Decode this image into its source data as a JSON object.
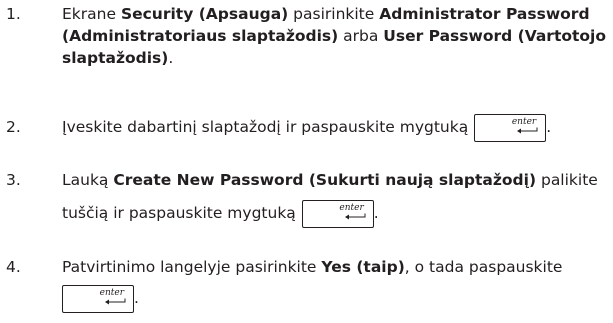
{
  "steps": [
    {
      "number": "1.",
      "line1": {
        "t1": "Ekrane ",
        "b1": "Security (Apsauga)",
        "t2": " pasirinkite ",
        "b2": "Administrator Password"
      },
      "line2": {
        "b1": "(Administratoriaus slaptažodis)",
        "t1": " arba ",
        "b2": "User Password (Vartotojo"
      },
      "line3": {
        "b1": "slaptažodis)",
        "t1": "."
      }
    },
    {
      "number": "2.",
      "text": "Įveskite dabartinį slaptažodį ir paspauskite mygtuką",
      "after_key": "."
    },
    {
      "number": "3.",
      "line1": {
        "t1": "Lauką ",
        "b1": "Create New Password (Sukurti naują slaptažodį)",
        "t2": " palikite"
      },
      "line2": {
        "t1": "tuščią ir paspauskite mygtuką",
        "after_key": "."
      }
    },
    {
      "number": "4.",
      "line1": {
        "t1": "Patvirtinimo langelyje pasirinkite ",
        "b1": "Yes (taip)",
        "t2": ", o tada paspauskite"
      },
      "after_key": "."
    }
  ],
  "enter_key": {
    "label": "enter",
    "icon": "return-arrow-icon"
  }
}
